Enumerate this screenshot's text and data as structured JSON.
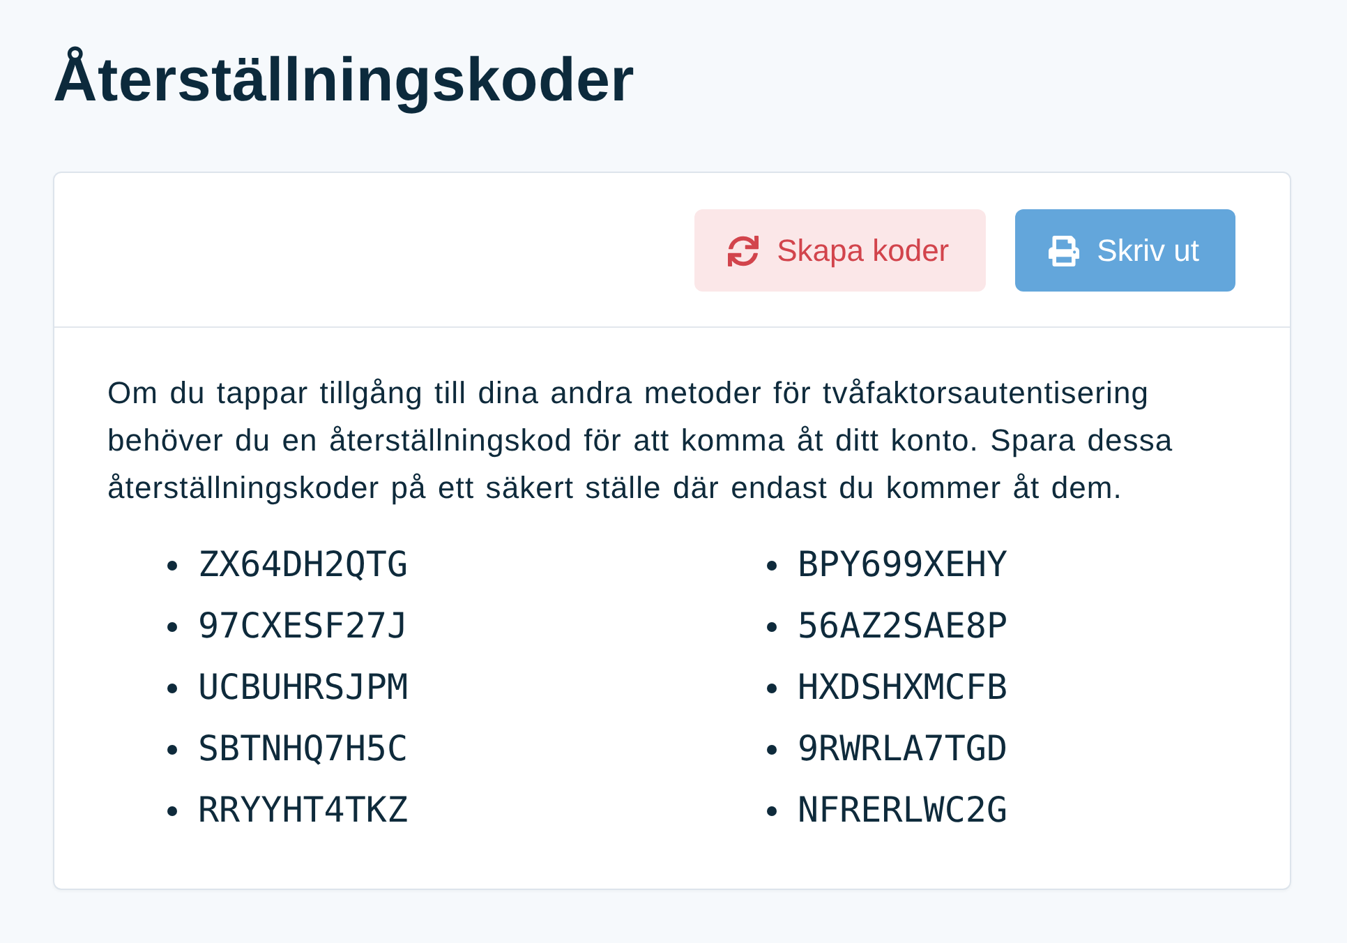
{
  "title": "Återställningskoder",
  "actions": [
    {
      "kind": "regenerate",
      "label": "Skapa koder"
    },
    {
      "kind": "print",
      "label": "Skriv ut"
    }
  ],
  "description": "Om du tappar tillgång till dina andra metoder för tvåfaktorsautentisering behöver du en återställningskod för att komma åt ditt konto. Spara dessa återställningskoder på ett säkert ställe där endast du kommer åt dem.",
  "codes": [
    "ZX64DH2QTG",
    "97CXESF27J",
    "UCBUHRSJPM",
    "SBTNHQ7H5C",
    "RRYYHT4TKZ",
    "BPY699XEHY",
    "56AZ2SAE8P",
    "HXDSHXMCFB",
    "9RWRLA7TGD",
    "NFRERLWC2G"
  ]
}
